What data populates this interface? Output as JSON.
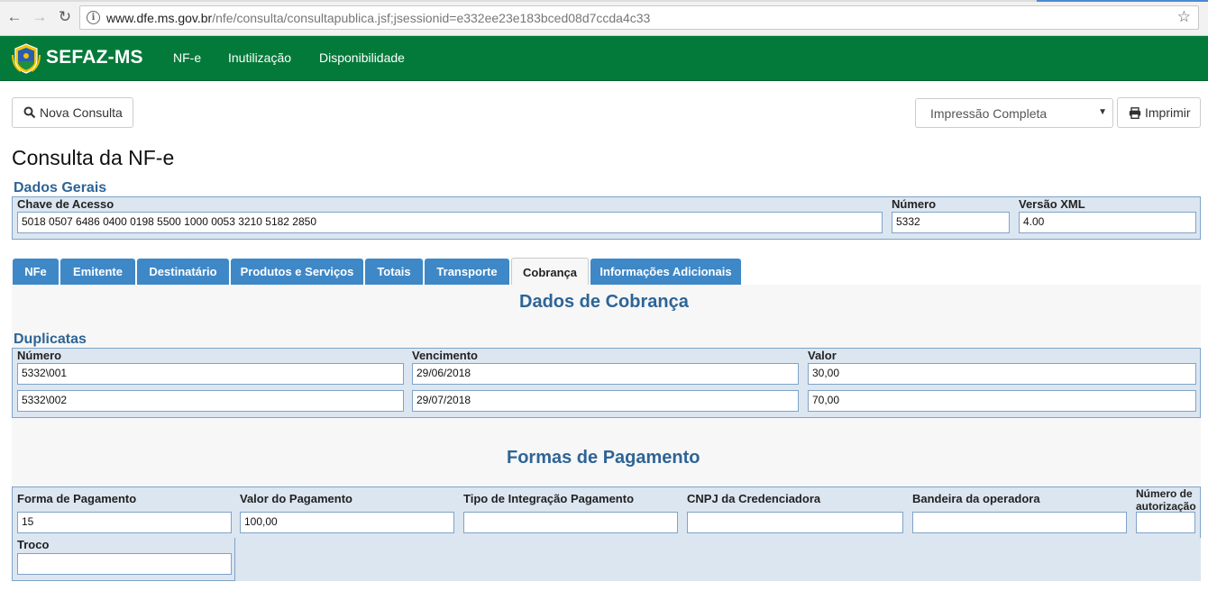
{
  "browser": {
    "url_host": "www.dfe.ms.gov.br",
    "url_path": "/nfe/consulta/consultapublica.jsf;jsessionid=e332ee23e183bced08d7ccda4c33"
  },
  "header": {
    "brand": "SEFAZ-MS",
    "menu": [
      "NF-e",
      "Inutilização",
      "Disponibilidade"
    ],
    "bg_color": "#047a3a"
  },
  "toolbar": {
    "nova_consulta": "Nova Consulta",
    "print_option": "Impressão Completa",
    "imprimir": "Imprimir"
  },
  "page_title": "Consulta da NF-e",
  "dados_gerais": {
    "title": "Dados Gerais",
    "chave_label": "Chave de Acesso",
    "chave_value": "5018 0507 6486 0400 0198 5500 1000 0053 3210 5182 2850",
    "numero_label": "Número",
    "numero_value": "5332",
    "versao_label": "Versão XML",
    "versao_value": "4.00"
  },
  "tabs": [
    {
      "label": "NFe"
    },
    {
      "label": "Emitente"
    },
    {
      "label": "Destinatário"
    },
    {
      "label": "Produtos e Serviços"
    },
    {
      "label": "Totais"
    },
    {
      "label": "Transporte"
    },
    {
      "label": "Cobrança",
      "active": true
    },
    {
      "label": "Informações Adicionais"
    }
  ],
  "cobranca": {
    "heading": "Dados de Cobrança",
    "duplicatas_title": "Duplicatas",
    "headers": [
      "Número",
      "Vencimento",
      "Valor"
    ],
    "rows": [
      [
        "5332\\001",
        "29/06/2018",
        "30,00"
      ],
      [
        "5332\\002",
        "29/07/2018",
        "70,00"
      ]
    ]
  },
  "pagamento": {
    "heading": "Formas de Pagamento",
    "forma_label": "Forma de Pagamento",
    "forma_value": "15",
    "valor_label": "Valor do Pagamento",
    "valor_value": "100,00",
    "tipo_label": "Tipo de Integração Pagamento",
    "tipo_value": "",
    "cnpj_label": "CNPJ da Credenciadora",
    "cnpj_value": "",
    "bandeira_label": "Bandeira da operadora",
    "bandeira_value": "",
    "autorizacao_label": "Número de autorização",
    "autorizacao_value": "",
    "troco_label": "Troco",
    "troco_value": ""
  }
}
